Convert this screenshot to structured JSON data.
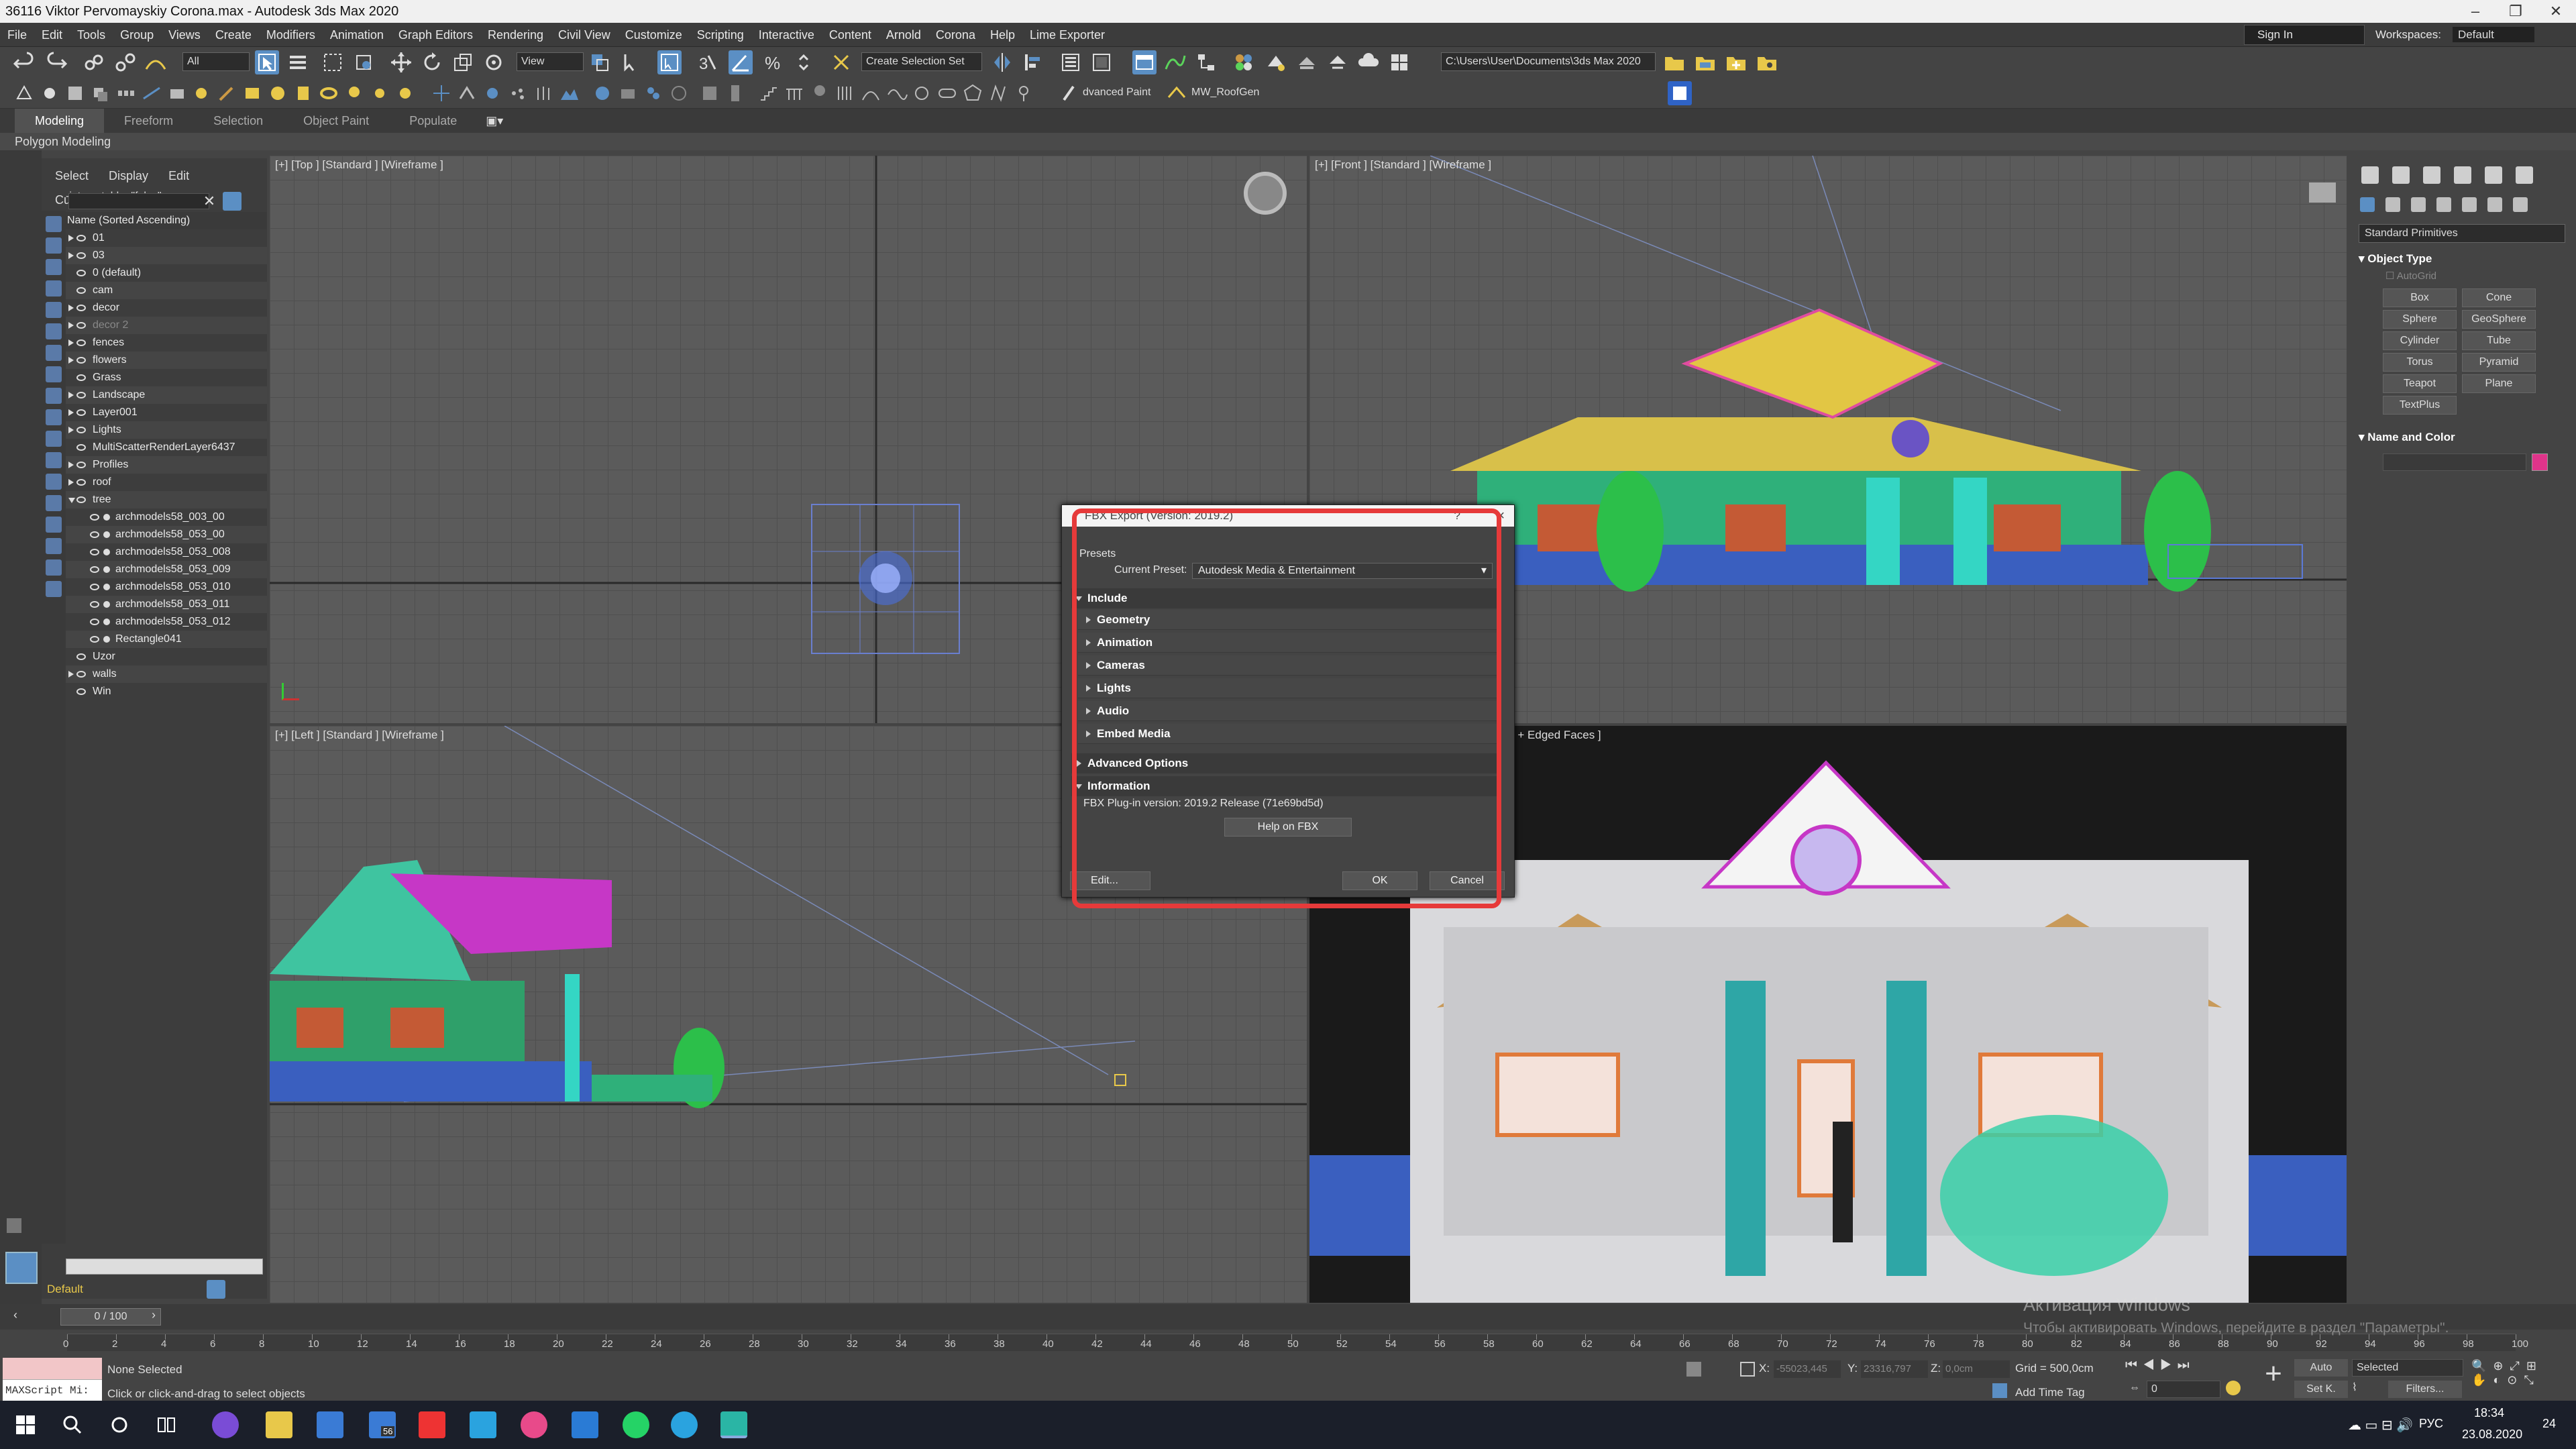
{
  "window": {
    "title": "36116 Viktor Pervomayskiy Corona.max - Autodesk 3ds Max 2020"
  },
  "menu": [
    "File",
    "Edit",
    "Tools",
    "Group",
    "Views",
    "Create",
    "Modifiers",
    "Animation",
    "Graph Editors",
    "Rendering",
    "Civil View",
    "Customize",
    "Scripting",
    "Interactive",
    "Content",
    "Arnold",
    "Corona",
    "Help",
    "Lime Exporter"
  ],
  "account": {
    "sign_in": "Sign In",
    "workspaces_label": "Workspaces:",
    "workspace": "Default"
  },
  "toolbar": {
    "selection_filter": "All",
    "ref_coord": "View",
    "create_selection_set": "Create Selection Set",
    "project_path": "C:\\Users\\User\\Documents\\3ds Max 2020",
    "plugin1": "dvanced Paint",
    "plugin2": "MW_RoofGen"
  },
  "ribbon": {
    "tabs": [
      "Modeling",
      "Freeform",
      "Selection",
      "Object Paint",
      "Populate"
    ],
    "active": "Modeling",
    "sub": "Polygon Modeling"
  },
  "scene_explorer": {
    "menu": [
      "Select",
      "Display",
      "Edit",
      "Customize"
    ],
    "header": "Name (Sorted Ascending)",
    "items": [
      {
        "name": "01",
        "indent": 0,
        "expand": true
      },
      {
        "name": "03",
        "indent": 0,
        "expand": true
      },
      {
        "name": "0 (default)",
        "indent": 0,
        "expand": false
      },
      {
        "name": "cam",
        "indent": 0,
        "expand": false
      },
      {
        "name": "decor",
        "indent": 0,
        "expand": true
      },
      {
        "name": "decor 2",
        "indent": 0,
        "expand": true,
        "dim": true
      },
      {
        "name": "fences",
        "indent": 0,
        "expand": true
      },
      {
        "name": "flowers",
        "indent": 0,
        "expand": true
      },
      {
        "name": "Grass",
        "indent": 0,
        "expand": false
      },
      {
        "name": "Landscape",
        "indent": 0,
        "expand": true
      },
      {
        "name": "Layer001",
        "indent": 0,
        "expand": true
      },
      {
        "name": "Lights",
        "indent": 0,
        "expand": true
      },
      {
        "name": "MultiScatterRenderLayer6437",
        "indent": 0,
        "expand": false
      },
      {
        "name": "Profiles",
        "indent": 0,
        "expand": true
      },
      {
        "name": "roof",
        "indent": 0,
        "expand": true
      },
      {
        "name": "tree",
        "indent": 0,
        "expand": true,
        "open": true
      },
      {
        "name": "archmodels58_003_00",
        "indent": 1,
        "expand": false
      },
      {
        "name": "archmodels58_053_00",
        "indent": 1,
        "expand": false
      },
      {
        "name": "archmodels58_053_008",
        "indent": 1,
        "expand": false
      },
      {
        "name": "archmodels58_053_009",
        "indent": 1,
        "expand": false
      },
      {
        "name": "archmodels58_053_010",
        "indent": 1,
        "expand": false
      },
      {
        "name": "archmodels58_053_011",
        "indent": 1,
        "expand": false
      },
      {
        "name": "archmodels58_053_012",
        "indent": 1,
        "expand": false
      },
      {
        "name": "Rectangle041",
        "indent": 1,
        "expand": false
      },
      {
        "name": "Uzor",
        "indent": 0,
        "expand": false
      },
      {
        "name": "walls",
        "indent": 0,
        "expand": true
      },
      {
        "name": "Win",
        "indent": 0,
        "expand": false
      }
    ],
    "layer": "Default"
  },
  "viewports": {
    "top": "[+] [Top ] [Standard ] [Wireframe ]",
    "front": "[+] [Front ] [Standard ] [Wireframe ]",
    "left": "[+] [Left ] [Standard ] [Wireframe ]",
    "persp": "r + Edged Faces ]"
  },
  "command_panel": {
    "dropdown": "Standard Primitives",
    "object_type": "Object Type",
    "autogrid": "AutoGrid",
    "buttons": [
      "Box",
      "Cone",
      "Sphere",
      "GeoSphere",
      "Cylinder",
      "Tube",
      "Torus",
      "Pyramid",
      "Teapot",
      "Plane",
      "TextPlus"
    ],
    "name_and_color": "Name and Color"
  },
  "dialog": {
    "title": "FBX Export (Version: 2019.2)",
    "help": "?",
    "close": "×",
    "presets": "Presets",
    "current_preset_label": "Current Preset:",
    "current_preset": "Autodesk Media & Entertainment",
    "include": "Include",
    "sections": [
      "Geometry",
      "Animation",
      "Cameras",
      "Lights",
      "Audio",
      "Embed Media"
    ],
    "advanced": "Advanced Options",
    "information": "Information",
    "plugin_version": "FBX Plug-in version: 2019.2 Release (71e69bd5d)",
    "help_btn": "Help on FBX",
    "edit_btn": "Edit...",
    "ok_btn": "OK",
    "cancel_btn": "Cancel"
  },
  "timeline": {
    "slider": "0 / 100",
    "ticks": [
      0,
      2,
      4,
      6,
      8,
      10,
      12,
      14,
      16,
      18,
      20,
      22,
      24,
      26,
      28,
      30,
      32,
      34,
      36,
      38,
      40,
      42,
      44,
      46,
      48,
      50,
      52,
      54,
      56,
      58,
      60,
      62,
      64,
      66,
      68,
      70,
      72,
      74,
      76,
      78,
      80,
      82,
      84,
      86,
      88,
      90,
      92,
      94,
      96,
      98,
      100
    ]
  },
  "status": {
    "maxscript": "MAXScript Mi:",
    "selection": "None Selected",
    "prompt": "Click or click-and-drag to select objects",
    "x_label": "X:",
    "x_val": "-55023,445",
    "y_label": "Y:",
    "y_val": "23316,797",
    "z_label": "Z:",
    "z_val": "0,0cm",
    "grid": "Grid = 500,0cm",
    "add_time_tag": "Add Time Tag",
    "frame": "0",
    "auto": "Auto",
    "set_key": "Set K.",
    "key_filter": "Selected",
    "filters": "Filters..."
  },
  "activation": {
    "title": "Активация Windows",
    "text": "Чтобы активировать Windows, перейдите в раздел \"Параметры\"."
  },
  "taskbar": {
    "lang": "РУС",
    "time": "18:34",
    "date": "23.08.2020",
    "notif": "24",
    "mail_badge": "56"
  }
}
